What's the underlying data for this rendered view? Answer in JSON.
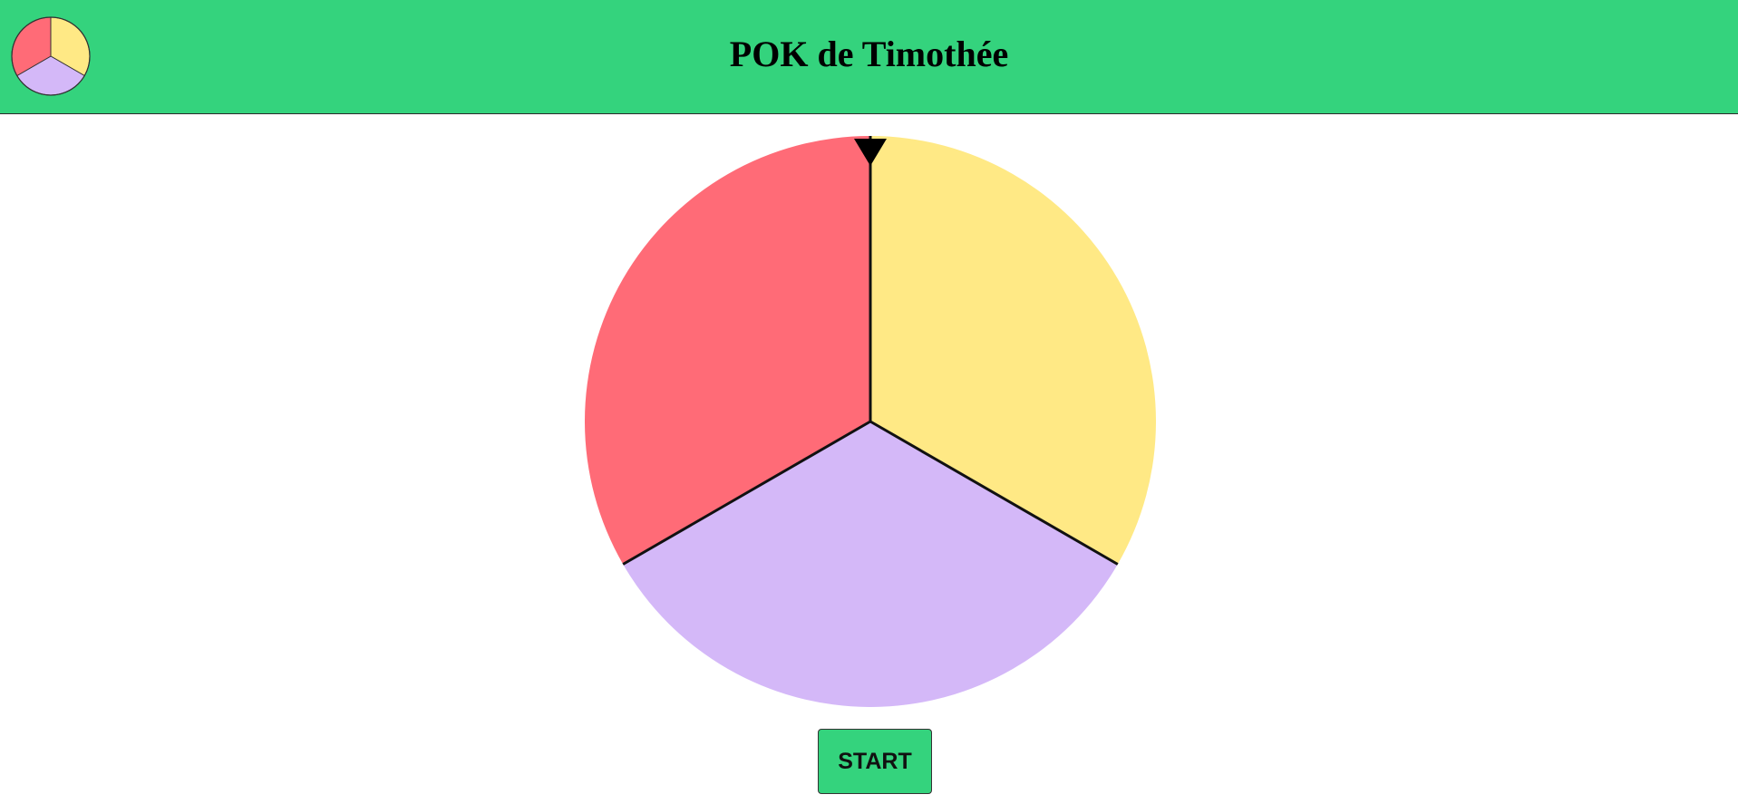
{
  "header": {
    "title": "POK de Timothée",
    "background_color": "#34d37d",
    "logo_icon": "wheel-logo-icon"
  },
  "wheel": {
    "segments": [
      {
        "color": "#ffe985"
      },
      {
        "color": "#d4b8f8"
      },
      {
        "color": "#ff6b77"
      }
    ],
    "pointer_icon": "pointer-triangle-icon"
  },
  "controls": {
    "start_label": "START",
    "start_color": "#34d37d"
  }
}
